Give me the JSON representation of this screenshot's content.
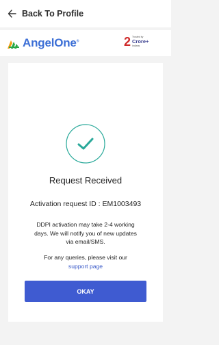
{
  "header": {
    "back_label": "Back To Profile"
  },
  "brand": {
    "name": "AngelOne",
    "trademark": "®"
  },
  "badge": {
    "number": "2",
    "word": "Crore+",
    "top": "Trusted by",
    "sub": "Indians"
  },
  "status": {
    "heading": "Request Received",
    "request_id": "Activation request ID : EM1003493",
    "info_line1": "DDPI activation may take 2-4 working",
    "info_line2": "days. We will notify you of new updates",
    "info_line3": "via email/SMS.",
    "queries": "For any queries, please visit our",
    "support_link": "support page"
  },
  "actions": {
    "okay_label": "OKAY"
  },
  "colors": {
    "accent": "#3f5bd1",
    "success": "#2aa99a",
    "brand": "#3c6fd6",
    "logo_green": "#28a745",
    "logo_orange": "#f39c12"
  }
}
